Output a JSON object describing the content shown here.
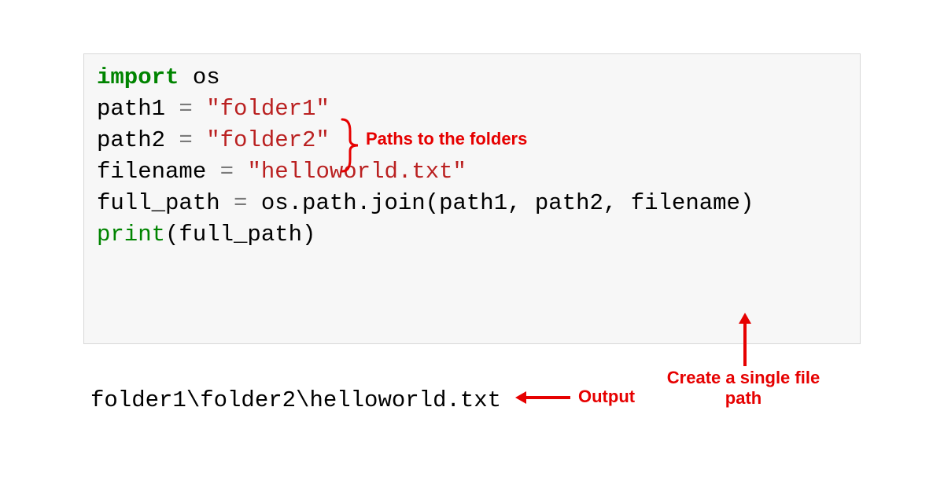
{
  "code": {
    "line1_kw": "import",
    "line1_mod": " os",
    "line2": "",
    "line3_var": "path1 ",
    "line3_eq": "=",
    "line3_sp": " ",
    "line3_str": "\"folder1\"",
    "line4_var": "path2 ",
    "line4_eq": "=",
    "line4_sp": " ",
    "line4_str": "\"folder2\"",
    "line5_var": "filename ",
    "line5_eq": "=",
    "line5_sp": " ",
    "line5_str": "\"helloworld.txt\"",
    "line6": "",
    "line7_var": "full_path ",
    "line7_eq": "=",
    "line7_rest": " os.path.join(path1, path2, filename)",
    "line8_func": "print",
    "line8_args": "(full_path)"
  },
  "output": "folder1\\folder2\\helloworld.txt",
  "annotations": {
    "paths": "Paths to the folders",
    "create_line1": "Create a single file",
    "create_line2": "path",
    "output_label": "Output"
  },
  "colors": {
    "annotation": "#e60000",
    "keyword": "#008400",
    "string": "#ba2121",
    "code_bg": "#f7f7f7"
  }
}
